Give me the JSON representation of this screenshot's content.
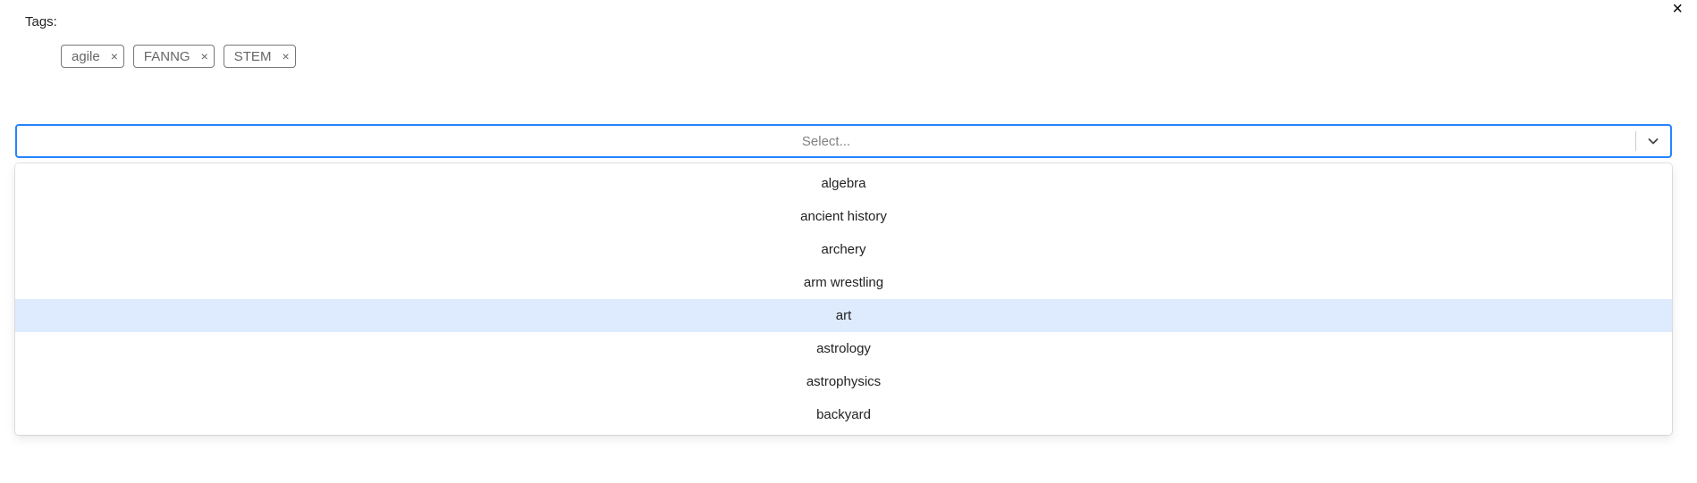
{
  "header": {
    "close_glyph": "×"
  },
  "tags": {
    "label": "Tags:",
    "selected": [
      {
        "text": "agile",
        "remove": "×"
      },
      {
        "text": "FANNG",
        "remove": "×"
      },
      {
        "text": "STEM",
        "remove": "×"
      }
    ]
  },
  "select": {
    "placeholder": "Select...",
    "accent_color": "#2684ff",
    "dropdown_icon": "chevron-down-icon"
  },
  "menu": {
    "highlight_color": "#deebff",
    "focused_option": "art",
    "options": [
      {
        "label": "algebra"
      },
      {
        "label": "ancient history"
      },
      {
        "label": "archery"
      },
      {
        "label": "arm wrestling"
      },
      {
        "label": "art"
      },
      {
        "label": "astrology"
      },
      {
        "label": "astrophysics"
      },
      {
        "label": "backyard"
      }
    ]
  }
}
